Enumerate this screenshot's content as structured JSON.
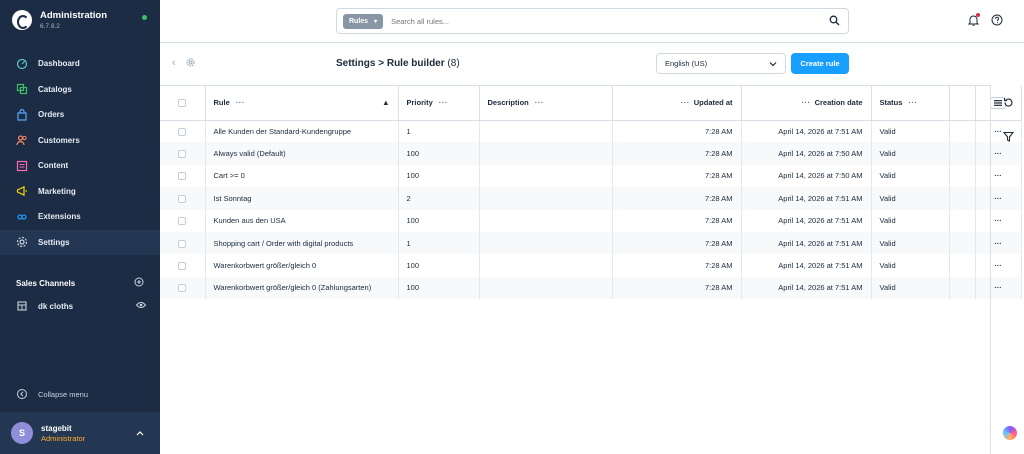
{
  "app": {
    "title": "Administration",
    "version": "6.7.8.2"
  },
  "sidebar": {
    "items": [
      {
        "label": "Dashboard",
        "icon": "dashboard-icon"
      },
      {
        "label": "Catalogs",
        "icon": "catalogs-icon"
      },
      {
        "label": "Orders",
        "icon": "orders-icon"
      },
      {
        "label": "Customers",
        "icon": "customers-icon"
      },
      {
        "label": "Content",
        "icon": "content-icon"
      },
      {
        "label": "Marketing",
        "icon": "marketing-icon"
      },
      {
        "label": "Extensions",
        "icon": "extensions-icon"
      },
      {
        "label": "Settings",
        "icon": "settings-icon",
        "active": true
      }
    ],
    "sales_channels_label": "Sales Channels",
    "sales_channel_item": "dk cloths",
    "collapse_label": "Collapse menu",
    "user": {
      "initial": "S",
      "name": "stagebit",
      "role": "Administrator"
    }
  },
  "topbar": {
    "search_type": "Rules",
    "search_placeholder": "Search all rules..."
  },
  "smartbar": {
    "title": "Settings > Rule builder",
    "count": "(8)",
    "language": "English (US)",
    "create_label": "Create rule"
  },
  "table": {
    "headers": {
      "rule": "Rule",
      "priority": "Priority",
      "description": "Description",
      "updated_at": "Updated at",
      "creation_date": "Creation date",
      "status": "Status"
    },
    "rows": [
      {
        "rule": "Alle Kunden der Standard-Kundengruppe",
        "priority": "1",
        "description": "",
        "updated": "7:28 AM",
        "created": "April 14, 2026 at 7:51 AM",
        "status": "Valid"
      },
      {
        "rule": "Always valid (Default)",
        "priority": "100",
        "description": "",
        "updated": "7:28 AM",
        "created": "April 14, 2026 at 7:50 AM",
        "status": "Valid"
      },
      {
        "rule": "Cart >= 0",
        "priority": "100",
        "description": "",
        "updated": "7:28 AM",
        "created": "April 14, 2026 at 7:50 AM",
        "status": "Valid"
      },
      {
        "rule": "Ist Sonntag",
        "priority": "2",
        "description": "",
        "updated": "7:28 AM",
        "created": "April 14, 2026 at 7:51 AM",
        "status": "Valid"
      },
      {
        "rule": "Kunden aus den USA",
        "priority": "100",
        "description": "",
        "updated": "7:28 AM",
        "created": "April 14, 2026 at 7:51 AM",
        "status": "Valid"
      },
      {
        "rule": "Shopping cart / Order with digital products",
        "priority": "1",
        "description": "",
        "updated": "7:28 AM",
        "created": "April 14, 2026 at 7:51 AM",
        "status": "Valid"
      },
      {
        "rule": "Warenkorbwert größer/gleich 0",
        "priority": "100",
        "description": "",
        "updated": "7:28 AM",
        "created": "April 14, 2026 at 7:51 AM",
        "status": "Valid"
      },
      {
        "rule": "Warenkorbwert größer/gleich 0 (Zahlungsarten)",
        "priority": "100",
        "description": "",
        "updated": "7:28 AM",
        "created": "April 14, 2026 at 7:51 AM",
        "status": "Valid"
      }
    ]
  },
  "colors": {
    "sidebar_bg": "#1c2c44",
    "primary": "#189eff",
    "role": "#ffae2c",
    "online": "#3cc261"
  }
}
